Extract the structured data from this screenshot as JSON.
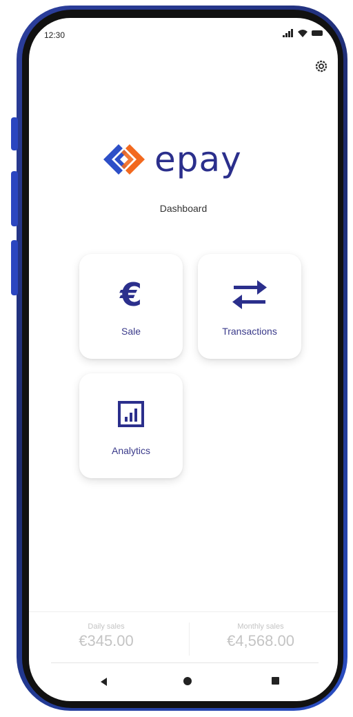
{
  "status_bar": {
    "time": "12:30"
  },
  "header": {
    "brand": "epay",
    "subtitle": "Dashboard"
  },
  "tiles": [
    {
      "label": "Sale",
      "icon": "euro-icon"
    },
    {
      "label": "Transactions",
      "icon": "swap-arrows-icon"
    },
    {
      "label": "Analytics",
      "icon": "chart-icon"
    }
  ],
  "summary": {
    "daily_label": "Daily sales",
    "daily_value": "€345.00",
    "monthly_label": "Monthly sales",
    "monthly_value": "€4,568.00"
  },
  "colors": {
    "primary": "#2b2f8c",
    "logo_blue": "#2d4fc7",
    "logo_orange": "#f2691f",
    "phone_frame": "#2c3f9e"
  }
}
